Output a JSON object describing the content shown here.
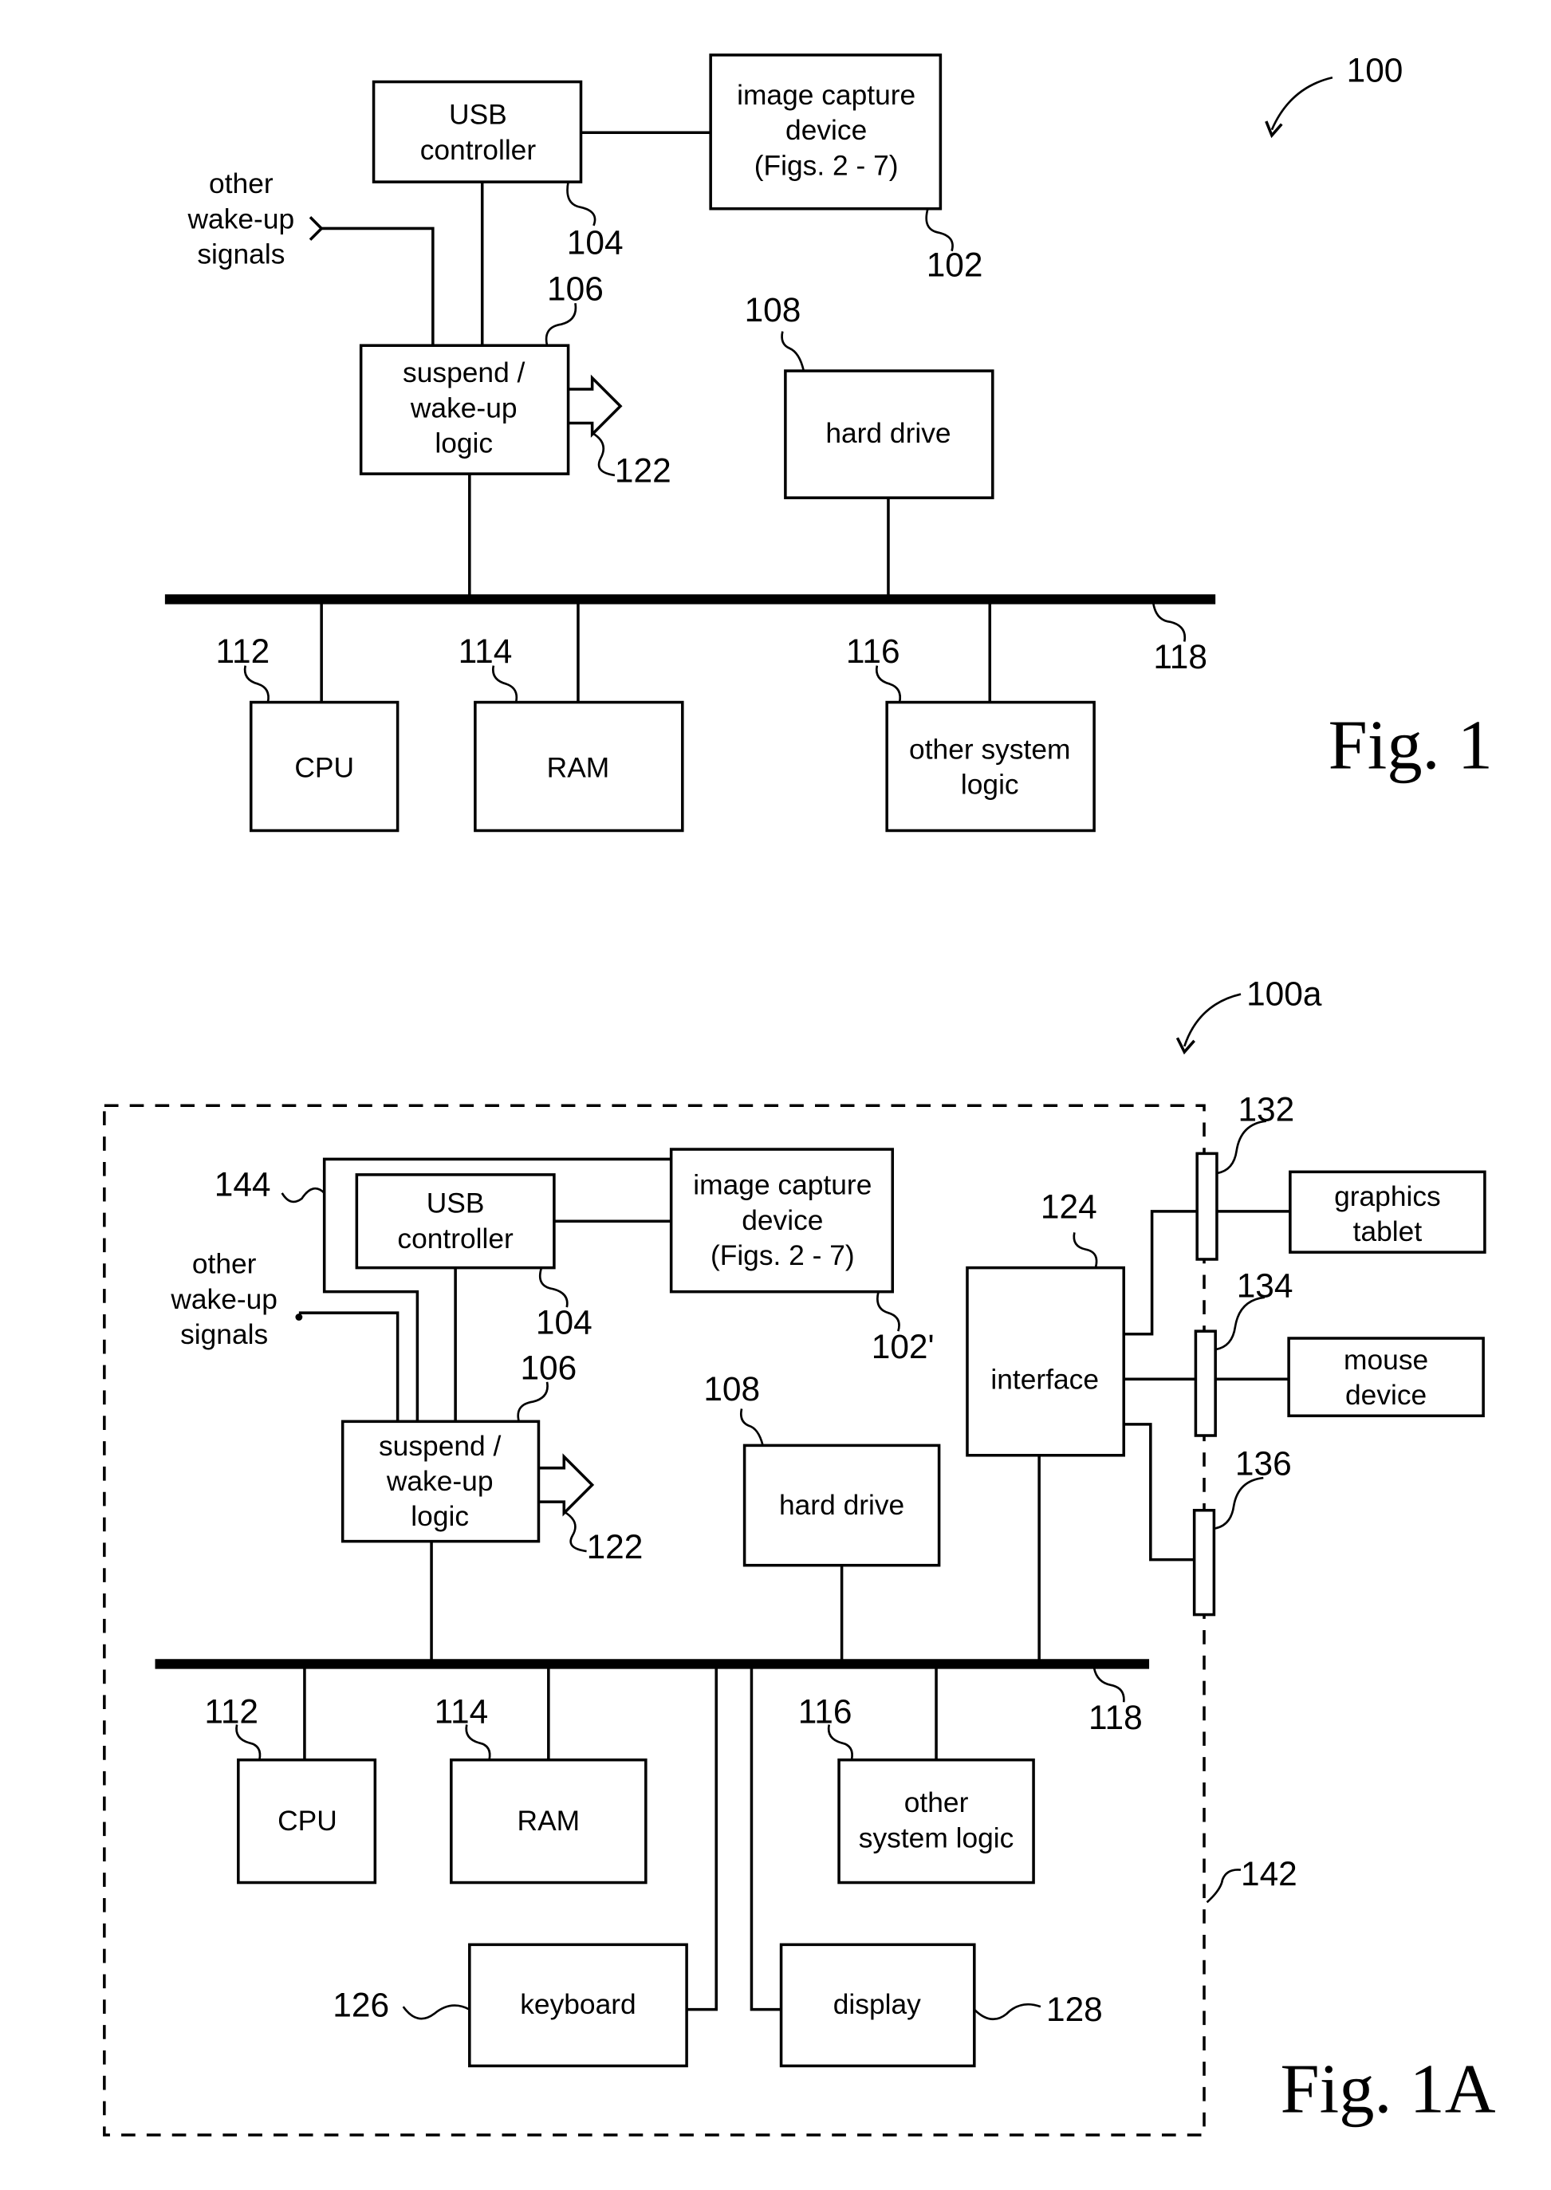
{
  "fig1": {
    "caption": "Fig. 1",
    "system_ref": "100",
    "blocks": {
      "usb": [
        "USB",
        "controller"
      ],
      "capture": [
        "image capture",
        "device",
        "(Figs. 2 - 7)"
      ],
      "suspend": [
        "suspend /",
        "wake-up",
        "logic"
      ],
      "hdd": [
        "hard drive"
      ],
      "cpu": [
        "CPU"
      ],
      "ram": [
        "RAM"
      ],
      "other": [
        "other system",
        "logic"
      ]
    },
    "wake_label": [
      "other",
      "wake-up",
      "signals"
    ],
    "refs": {
      "usb": "104",
      "capture": "102",
      "suspend": "106",
      "hdd": "108",
      "cpu": "112",
      "ram": "114",
      "other": "116",
      "bus": "118",
      "out": "122"
    }
  },
  "fig1a": {
    "caption": "Fig. 1A",
    "system_ref": "100a",
    "blocks": {
      "usb": [
        "USB",
        "controller"
      ],
      "capture": [
        "image capture",
        "device",
        "(Figs. 2 - 7)"
      ],
      "suspend": [
        "suspend /",
        "wake-up",
        "logic"
      ],
      "hdd": [
        "hard drive"
      ],
      "iface": [
        "interface"
      ],
      "cpu": [
        "CPU"
      ],
      "ram": [
        "RAM"
      ],
      "other": [
        "other",
        "system logic"
      ],
      "keyboard": [
        "keyboard"
      ],
      "display": [
        "display"
      ],
      "tablet": [
        "graphics",
        "tablet"
      ],
      "mouse": [
        "mouse",
        "device"
      ]
    },
    "wake_label": [
      "other",
      "wake-up",
      "signals"
    ],
    "refs": {
      "usb": "104",
      "capture": "102'",
      "suspend": "106",
      "hdd": "108",
      "iface": "124",
      "cpu": "112",
      "ram": "114",
      "other": "116",
      "bus": "118",
      "out": "122",
      "keyboard": "126",
      "display": "128",
      "port1": "132",
      "port2": "134",
      "port3": "136",
      "enclosure": "142",
      "wake_line": "144"
    }
  }
}
